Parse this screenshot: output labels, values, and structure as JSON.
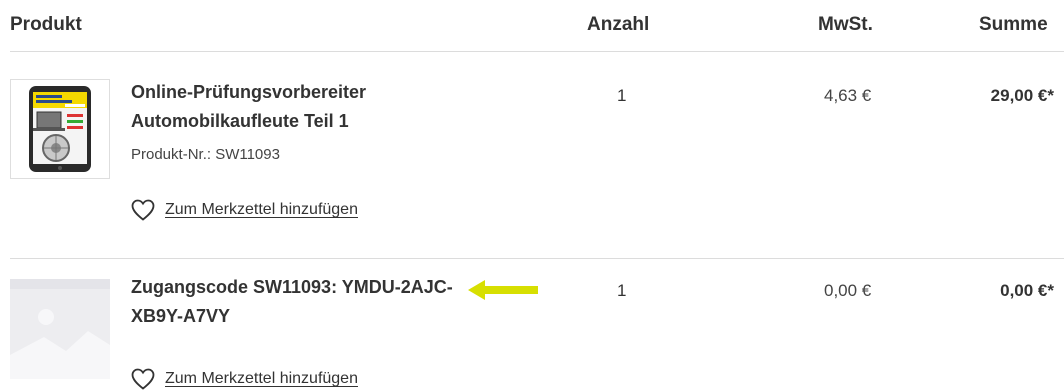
{
  "header": {
    "product": "Produkt",
    "quantity": "Anzahl",
    "vat": "MwSt.",
    "sum": "Summe"
  },
  "items": [
    {
      "title_line1": "Online-Prüfungsvorbereiter",
      "title_line2": "Automobilkaufleute Teil 1",
      "product_number": "Produkt-Nr.: SW11093",
      "quantity": "1",
      "vat": "4,63 €",
      "sum": "29,00 €*",
      "wishlist_label": "Zum Merkzettel hinzufügen",
      "thumbnail": "tablet-product-cover"
    },
    {
      "title_line1": "Zugangscode SW11093: YMDU-2AJC-",
      "title_line2": "XB9Y-A7VY",
      "quantity": "1",
      "vat": "0,00 €",
      "sum": "0,00 €*",
      "wishlist_label": "Zum Merkzettel hinzufügen",
      "thumbnail": "image-placeholder"
    }
  ],
  "colors": {
    "annotation_arrow": "#d7df01",
    "divider": "#dcdcdc",
    "text": "#333333"
  },
  "icons": {
    "wishlist": "heart-outline-icon",
    "annotation": "arrow-left-icon"
  }
}
